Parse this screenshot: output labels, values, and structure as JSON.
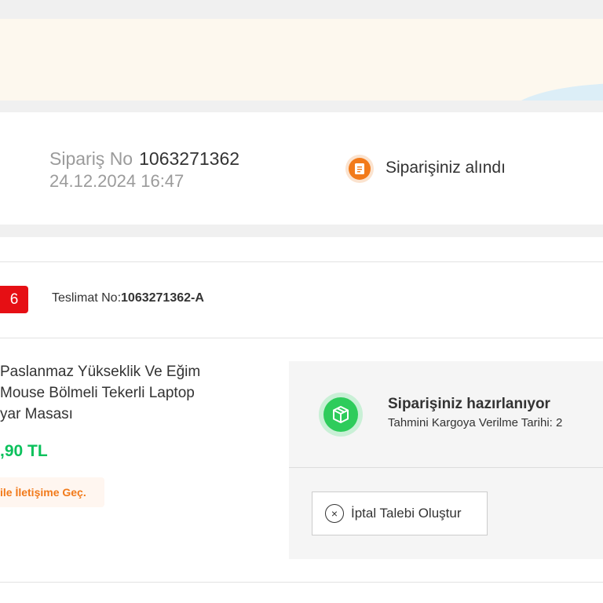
{
  "order": {
    "label": "Sipariş No",
    "number": "1063271362",
    "date": "24.12.2024 16:47",
    "status": "Siparişiniz alındı",
    "status_icon": "receipt-icon",
    "status_color": "#f27a1a"
  },
  "delivery": {
    "badge": "6",
    "no_label": "Teslimat No:",
    "no_value": "1063271362-A"
  },
  "product": {
    "name_lines": [
      "Paslanmaz Yükseklik Ve Eğim",
      "Mouse Bölmeli Tekerli Laptop",
      "yar Masası"
    ],
    "price": ",90 TL",
    "price_color": "#0bc15c",
    "contact_label": "ile İletişime Geç."
  },
  "shipment": {
    "status_title": "Siparişiniz hazırlanıyor",
    "estimate_text": "Tahmini Kargoya Verilme Tarihi: 2",
    "icon": "package-icon",
    "icon_color": "#2ecc5b",
    "cancel_label": "İptal Talebi Oluştur",
    "cancel_icon": "close-circle-icon"
  }
}
